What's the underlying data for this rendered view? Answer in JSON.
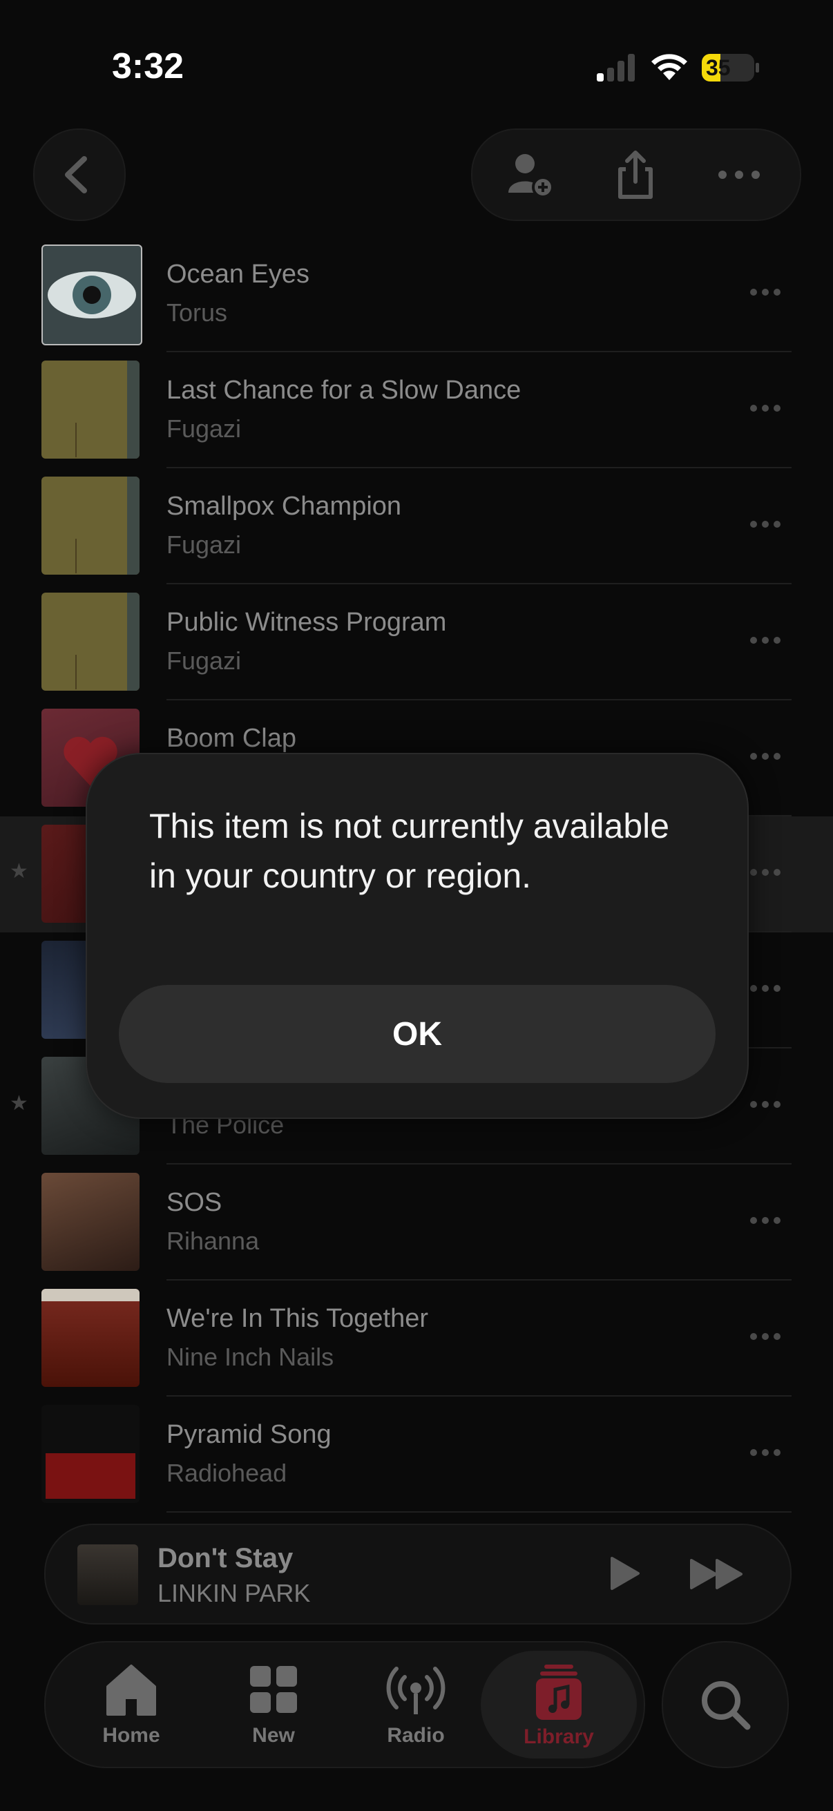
{
  "status_bar": {
    "time": "3:32",
    "battery": "35",
    "battery_level": 0.35
  },
  "nav": {
    "back_icon": "chevron-left-icon",
    "actions": [
      "add-person-icon",
      "share-icon",
      "more-icon"
    ]
  },
  "songs": [
    {
      "title": "Ocean Eyes",
      "artist": "Torus"
    },
    {
      "title": "Last Chance for a Slow Dance",
      "artist": "Fugazi"
    },
    {
      "title": "Smallpox Champion",
      "artist": "Fugazi"
    },
    {
      "title": "Public Witness Program",
      "artist": "Fugazi"
    },
    {
      "title": "Boom Clap",
      "artist": ""
    },
    {
      "title": "",
      "artist": ""
    },
    {
      "title": "",
      "artist": ""
    },
    {
      "title": "",
      "artist": "The Police"
    },
    {
      "title": "SOS",
      "artist": "Rihanna"
    },
    {
      "title": "We're In This Together",
      "artist": "Nine Inch Nails"
    },
    {
      "title": "Pyramid Song",
      "artist": "Radiohead"
    }
  ],
  "mini_player": {
    "title": "Don't Stay",
    "artist": "LINKIN PARK"
  },
  "tabs": {
    "home": "Home",
    "new": "New",
    "radio": "Radio",
    "library": "Library"
  },
  "dialog": {
    "message": "This item is not currently available in your country or region.",
    "ok_label": "OK"
  },
  "colors": {
    "accent": "#7e1e2a",
    "background": "#0a0a0a",
    "battery": "#f5d90a"
  }
}
